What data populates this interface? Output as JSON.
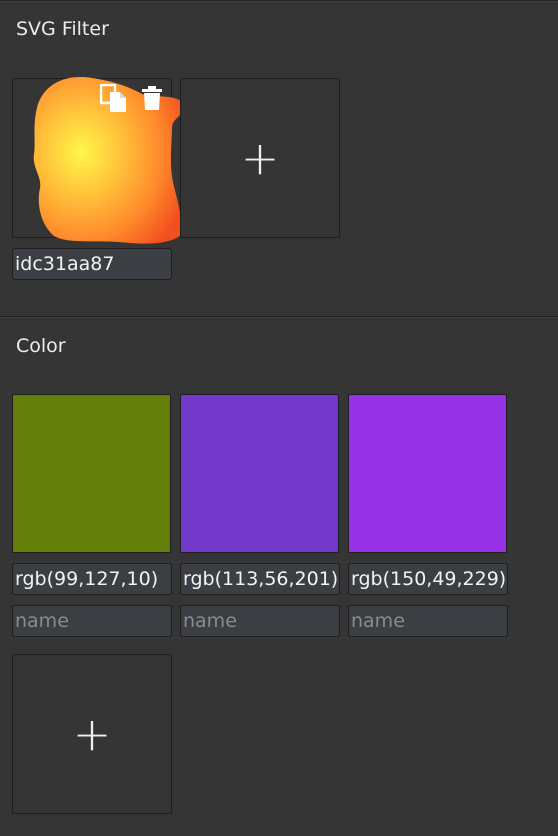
{
  "svg_filter": {
    "title": "SVG Filter",
    "items": [
      {
        "id_value": "idc31aa87",
        "icons": [
          "copy-icon",
          "trash-icon"
        ]
      }
    ],
    "add_label": "+"
  },
  "color": {
    "title": "Color",
    "swatches": [
      {
        "color": "#637f0a",
        "value": "rgb(99,127,10)",
        "name_placeholder": "name"
      },
      {
        "color": "#7138c9",
        "value": "rgb(113,56,201)",
        "name_placeholder": "name"
      },
      {
        "color": "#9631e5",
        "value": "rgb(150,49,229)",
        "name_placeholder": "name"
      }
    ],
    "add_label": "+"
  }
}
